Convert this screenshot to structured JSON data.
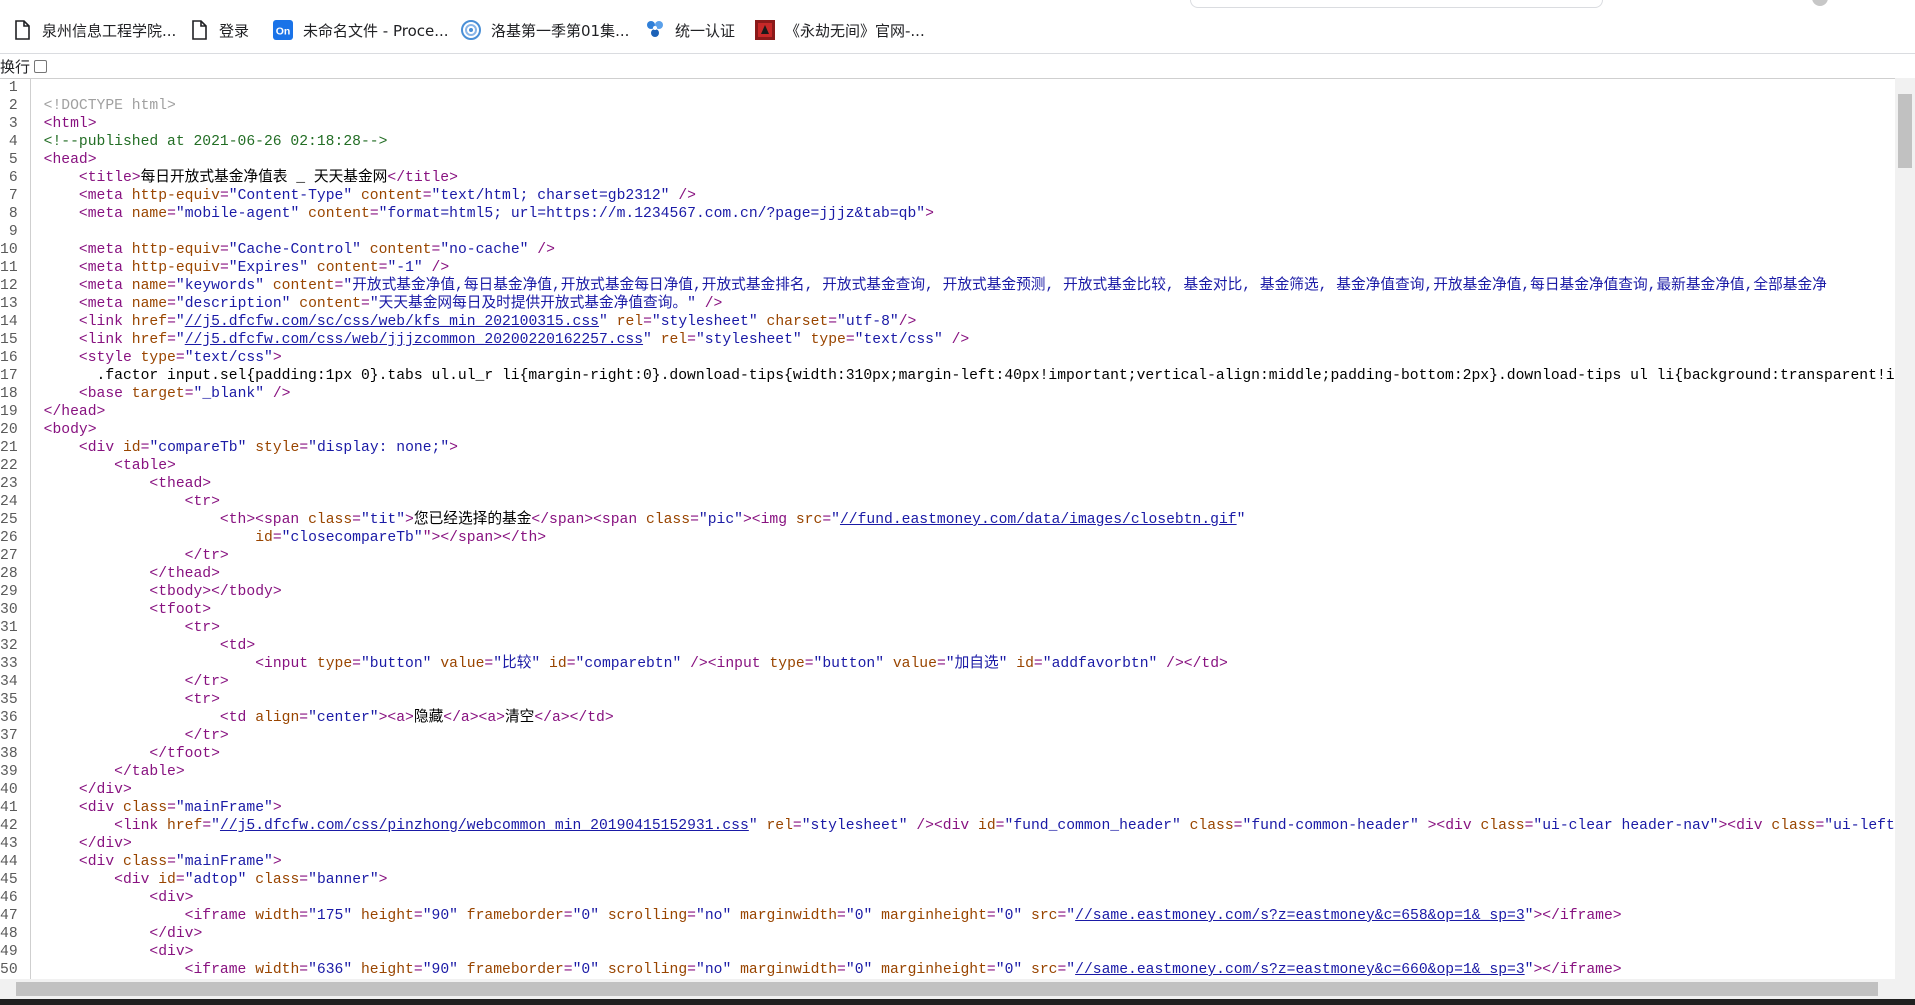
{
  "bookmarks": [
    {
      "label": "泉州信息工程学院...",
      "icon": "page-icon"
    },
    {
      "label": "登录",
      "icon": "page-icon"
    },
    {
      "label": "未命名文件 - Proce...",
      "icon": "processon-icon"
    },
    {
      "label": "洛基第一季第01集...",
      "icon": "swirl-icon"
    },
    {
      "label": "统一认证",
      "icon": "fan-icon"
    },
    {
      "label": "《永劫无间》官网-...",
      "icon": "game-icon"
    }
  ],
  "toolbar": {
    "wrap_label": "换行"
  },
  "lines": [
    [],
    [
      {
        "c": "dt",
        "t": "<!DOCTYPE html>"
      }
    ],
    [
      {
        "c": "tg",
        "t": "<html>"
      }
    ],
    [
      {
        "c": "cm",
        "t": "<!--published at 2021-06-26 02:18:28-->"
      }
    ],
    [
      {
        "c": "tg",
        "t": "<head>"
      }
    ],
    [
      {
        "c": "",
        "t": "    "
      },
      {
        "c": "tg",
        "t": "<title>"
      },
      {
        "c": "",
        "t": "每日开放式基金净值表 _ 天天基金网"
      },
      {
        "c": "tg",
        "t": "</title>"
      }
    ],
    [
      {
        "c": "",
        "t": "    "
      },
      {
        "c": "tg",
        "t": "<meta "
      },
      {
        "c": "an",
        "t": "http-equiv"
      },
      {
        "c": "tg",
        "t": "="
      },
      {
        "c": "av",
        "t": "\"Content-Type\""
      },
      {
        "c": "an",
        "t": " content"
      },
      {
        "c": "tg",
        "t": "="
      },
      {
        "c": "av",
        "t": "\"text/html; charset=gb2312\""
      },
      {
        "c": "tg",
        "t": " />"
      }
    ],
    [
      {
        "c": "",
        "t": "    "
      },
      {
        "c": "tg",
        "t": "<meta "
      },
      {
        "c": "an",
        "t": "name"
      },
      {
        "c": "tg",
        "t": "="
      },
      {
        "c": "av",
        "t": "\"mobile-agent\""
      },
      {
        "c": "an",
        "t": " content"
      },
      {
        "c": "tg",
        "t": "="
      },
      {
        "c": "av",
        "t": "\"format=html5; url=https://m.1234567.com.cn/?page=jjjz&tab=qb\""
      },
      {
        "c": "tg",
        "t": ">"
      }
    ],
    [],
    [
      {
        "c": "",
        "t": "    "
      },
      {
        "c": "tg",
        "t": "<meta "
      },
      {
        "c": "an",
        "t": "http-equiv"
      },
      {
        "c": "tg",
        "t": "="
      },
      {
        "c": "av",
        "t": "\"Cache-Control\""
      },
      {
        "c": "an",
        "t": " content"
      },
      {
        "c": "tg",
        "t": "="
      },
      {
        "c": "av",
        "t": "\"no-cache\""
      },
      {
        "c": "tg",
        "t": " />"
      }
    ],
    [
      {
        "c": "",
        "t": "    "
      },
      {
        "c": "tg",
        "t": "<meta "
      },
      {
        "c": "an",
        "t": "http-equiv"
      },
      {
        "c": "tg",
        "t": "="
      },
      {
        "c": "av",
        "t": "\"Expires\""
      },
      {
        "c": "an",
        "t": " content"
      },
      {
        "c": "tg",
        "t": "="
      },
      {
        "c": "av",
        "t": "\"-1\""
      },
      {
        "c": "tg",
        "t": " />"
      }
    ],
    [
      {
        "c": "",
        "t": "    "
      },
      {
        "c": "tg",
        "t": "<meta "
      },
      {
        "c": "an",
        "t": "name"
      },
      {
        "c": "tg",
        "t": "="
      },
      {
        "c": "av",
        "t": "\"keywords\""
      },
      {
        "c": "an",
        "t": " content"
      },
      {
        "c": "tg",
        "t": "="
      },
      {
        "c": "av",
        "t": "\"开放式基金净值,每日基金净值,开放式基金每日净值,开放式基金排名, 开放式基金查询, 开放式基金预测, 开放式基金比较, 基金对比, 基金筛选, 基金净值查询,开放基金净值,每日基金净值查询,最新基金净值,全部基金净"
      }
    ],
    [
      {
        "c": "",
        "t": "    "
      },
      {
        "c": "tg",
        "t": "<meta "
      },
      {
        "c": "an",
        "t": "name"
      },
      {
        "c": "tg",
        "t": "="
      },
      {
        "c": "av",
        "t": "\"description\""
      },
      {
        "c": "an",
        "t": " content"
      },
      {
        "c": "tg",
        "t": "="
      },
      {
        "c": "av",
        "t": "\"天天基金网每日及时提供开放式基金净值查询。\""
      },
      {
        "c": "tg",
        "t": " />"
      }
    ],
    [
      {
        "c": "",
        "t": "    "
      },
      {
        "c": "tg",
        "t": "<link "
      },
      {
        "c": "an",
        "t": "href"
      },
      {
        "c": "tg",
        "t": "="
      },
      {
        "c": "av",
        "t": "\""
      },
      {
        "c": "lk",
        "t": "//j5.dfcfw.com/sc/css/web/kfs_min_202100315.css"
      },
      {
        "c": "av",
        "t": "\""
      },
      {
        "c": "an",
        "t": " rel"
      },
      {
        "c": "tg",
        "t": "="
      },
      {
        "c": "av",
        "t": "\"stylesheet\""
      },
      {
        "c": "an",
        "t": " charset"
      },
      {
        "c": "tg",
        "t": "="
      },
      {
        "c": "av",
        "t": "\"utf-8\""
      },
      {
        "c": "tg",
        "t": "/>"
      }
    ],
    [
      {
        "c": "",
        "t": "    "
      },
      {
        "c": "tg",
        "t": "<link "
      },
      {
        "c": "an",
        "t": "href"
      },
      {
        "c": "tg",
        "t": "="
      },
      {
        "c": "av",
        "t": "\""
      },
      {
        "c": "lk",
        "t": "//j5.dfcfw.com/css/web/jjjzcommon_20200220162257.css"
      },
      {
        "c": "av",
        "t": "\""
      },
      {
        "c": "an",
        "t": " rel"
      },
      {
        "c": "tg",
        "t": "="
      },
      {
        "c": "av",
        "t": "\"stylesheet\""
      },
      {
        "c": "an",
        "t": " type"
      },
      {
        "c": "tg",
        "t": "="
      },
      {
        "c": "av",
        "t": "\"text/css\""
      },
      {
        "c": "tg",
        "t": " />"
      }
    ],
    [
      {
        "c": "",
        "t": "    "
      },
      {
        "c": "tg",
        "t": "<style "
      },
      {
        "c": "an",
        "t": "type"
      },
      {
        "c": "tg",
        "t": "="
      },
      {
        "c": "av",
        "t": "\"text/css\""
      },
      {
        "c": "tg",
        "t": ">"
      }
    ],
    [
      {
        "c": "",
        "t": "      .factor input.sel{padding:1px 0}.tabs ul.ul_r li{margin-right:0}.download-tips{width:310px;margin-left:40px!important;vertical-align:middle;padding-bottom:2px}.download-tips ul li{background:transparent!important;width:310px!"
      }
    ],
    [
      {
        "c": "",
        "t": "    "
      },
      {
        "c": "tg",
        "t": "<base "
      },
      {
        "c": "an",
        "t": "target"
      },
      {
        "c": "tg",
        "t": "="
      },
      {
        "c": "av",
        "t": "\"_blank\""
      },
      {
        "c": "tg",
        "t": " />"
      }
    ],
    [
      {
        "c": "tg",
        "t": "</head>"
      }
    ],
    [
      {
        "c": "tg",
        "t": "<body>"
      }
    ],
    [
      {
        "c": "",
        "t": "    "
      },
      {
        "c": "tg",
        "t": "<div "
      },
      {
        "c": "an",
        "t": "id"
      },
      {
        "c": "tg",
        "t": "="
      },
      {
        "c": "av",
        "t": "\"compareTb\""
      },
      {
        "c": "an",
        "t": " style"
      },
      {
        "c": "tg",
        "t": "="
      },
      {
        "c": "av",
        "t": "\"display: none;\""
      },
      {
        "c": "tg",
        "t": ">"
      }
    ],
    [
      {
        "c": "",
        "t": "        "
      },
      {
        "c": "tg",
        "t": "<table>"
      }
    ],
    [
      {
        "c": "",
        "t": "            "
      },
      {
        "c": "tg",
        "t": "<thead>"
      }
    ],
    [
      {
        "c": "",
        "t": "                "
      },
      {
        "c": "tg",
        "t": "<tr>"
      }
    ],
    [
      {
        "c": "",
        "t": "                    "
      },
      {
        "c": "tg",
        "t": "<th><span "
      },
      {
        "c": "an",
        "t": "class"
      },
      {
        "c": "tg",
        "t": "="
      },
      {
        "c": "av",
        "t": "\"tit\""
      },
      {
        "c": "tg",
        "t": ">"
      },
      {
        "c": "",
        "t": "您已经选择的基金"
      },
      {
        "c": "tg",
        "t": "</span><span "
      },
      {
        "c": "an",
        "t": "class"
      },
      {
        "c": "tg",
        "t": "="
      },
      {
        "c": "av",
        "t": "\"pic\""
      },
      {
        "c": "tg",
        "t": "><img "
      },
      {
        "c": "an",
        "t": "src"
      },
      {
        "c": "tg",
        "t": "="
      },
      {
        "c": "av",
        "t": "\""
      },
      {
        "c": "lk",
        "t": "//fund.eastmoney.com/data/images/closebtn.gif"
      },
      {
        "c": "av",
        "t": "\""
      }
    ],
    [
      {
        "c": "",
        "t": "                        "
      },
      {
        "c": "an",
        "t": "id"
      },
      {
        "c": "tg",
        "t": "="
      },
      {
        "c": "av",
        "t": "\"closecompareTb\""
      },
      {
        "c": "tg",
        "t": "\"></span></th>"
      }
    ],
    [
      {
        "c": "",
        "t": "                "
      },
      {
        "c": "tg",
        "t": "</tr>"
      }
    ],
    [
      {
        "c": "",
        "t": "            "
      },
      {
        "c": "tg",
        "t": "</thead>"
      }
    ],
    [
      {
        "c": "",
        "t": "            "
      },
      {
        "c": "tg",
        "t": "<tbody></tbody>"
      }
    ],
    [
      {
        "c": "",
        "t": "            "
      },
      {
        "c": "tg",
        "t": "<tfoot>"
      }
    ],
    [
      {
        "c": "",
        "t": "                "
      },
      {
        "c": "tg",
        "t": "<tr>"
      }
    ],
    [
      {
        "c": "",
        "t": "                    "
      },
      {
        "c": "tg",
        "t": "<td>"
      }
    ],
    [
      {
        "c": "",
        "t": "                        "
      },
      {
        "c": "tg",
        "t": "<input "
      },
      {
        "c": "an",
        "t": "type"
      },
      {
        "c": "tg",
        "t": "="
      },
      {
        "c": "av",
        "t": "\"button\""
      },
      {
        "c": "an",
        "t": " value"
      },
      {
        "c": "tg",
        "t": "="
      },
      {
        "c": "av",
        "t": "\"比较\""
      },
      {
        "c": "an",
        "t": " id"
      },
      {
        "c": "tg",
        "t": "="
      },
      {
        "c": "av",
        "t": "\"comparebtn\""
      },
      {
        "c": "tg",
        "t": " /><input "
      },
      {
        "c": "an",
        "t": "type"
      },
      {
        "c": "tg",
        "t": "="
      },
      {
        "c": "av",
        "t": "\"button\""
      },
      {
        "c": "an",
        "t": " value"
      },
      {
        "c": "tg",
        "t": "="
      },
      {
        "c": "av",
        "t": "\"加自选\""
      },
      {
        "c": "an",
        "t": " id"
      },
      {
        "c": "tg",
        "t": "="
      },
      {
        "c": "av",
        "t": "\"addfavorbtn\""
      },
      {
        "c": "tg",
        "t": " /></td>"
      }
    ],
    [
      {
        "c": "",
        "t": "                "
      },
      {
        "c": "tg",
        "t": "</tr>"
      }
    ],
    [
      {
        "c": "",
        "t": "                "
      },
      {
        "c": "tg",
        "t": "<tr>"
      }
    ],
    [
      {
        "c": "",
        "t": "                    "
      },
      {
        "c": "tg",
        "t": "<td "
      },
      {
        "c": "an",
        "t": "align"
      },
      {
        "c": "tg",
        "t": "="
      },
      {
        "c": "av",
        "t": "\"center\""
      },
      {
        "c": "tg",
        "t": "><a>"
      },
      {
        "c": "",
        "t": "隐藏"
      },
      {
        "c": "tg",
        "t": "</a><a>"
      },
      {
        "c": "",
        "t": "清空"
      },
      {
        "c": "tg",
        "t": "</a></td>"
      }
    ],
    [
      {
        "c": "",
        "t": "                "
      },
      {
        "c": "tg",
        "t": "</tr>"
      }
    ],
    [
      {
        "c": "",
        "t": "            "
      },
      {
        "c": "tg",
        "t": "</tfoot>"
      }
    ],
    [
      {
        "c": "",
        "t": "        "
      },
      {
        "c": "tg",
        "t": "</table>"
      }
    ],
    [
      {
        "c": "",
        "t": "    "
      },
      {
        "c": "tg",
        "t": "</div>"
      }
    ],
    [
      {
        "c": "",
        "t": "    "
      },
      {
        "c": "tg",
        "t": "<div "
      },
      {
        "c": "an",
        "t": "class"
      },
      {
        "c": "tg",
        "t": "="
      },
      {
        "c": "av",
        "t": "\"mainFrame\""
      },
      {
        "c": "tg",
        "t": ">"
      }
    ],
    [
      {
        "c": "",
        "t": "        "
      },
      {
        "c": "tg",
        "t": "<link "
      },
      {
        "c": "an",
        "t": "href"
      },
      {
        "c": "tg",
        "t": "="
      },
      {
        "c": "av",
        "t": "\""
      },
      {
        "c": "lk",
        "t": "//j5.dfcfw.com/css/pinzhong/webcommon_min_20190415152931.css"
      },
      {
        "c": "av",
        "t": "\""
      },
      {
        "c": "an",
        "t": " rel"
      },
      {
        "c": "tg",
        "t": "="
      },
      {
        "c": "av",
        "t": "\"stylesheet\""
      },
      {
        "c": "tg",
        "t": " /><div "
      },
      {
        "c": "an",
        "t": "id"
      },
      {
        "c": "tg",
        "t": "="
      },
      {
        "c": "av",
        "t": "\"fund_common_header\""
      },
      {
        "c": "an",
        "t": " class"
      },
      {
        "c": "tg",
        "t": "="
      },
      {
        "c": "av",
        "t": "\"fund-common-header\""
      },
      {
        "c": "tg",
        "t": " ><div "
      },
      {
        "c": "an",
        "t": "class"
      },
      {
        "c": "tg",
        "t": "="
      },
      {
        "c": "av",
        "t": "\"ui-clear header-nav\""
      },
      {
        "c": "tg",
        "t": "><div "
      },
      {
        "c": "an",
        "t": "class"
      },
      {
        "c": "tg",
        "t": "="
      },
      {
        "c": "av",
        "t": "\"ui-left\""
      },
      {
        "c": "tg",
        "t": "><ul><li "
      },
      {
        "c": "an",
        "t": "class"
      },
      {
        "c": "tg",
        "t": "="
      },
      {
        "c": "av",
        "t": "\"head"
      }
    ],
    [
      {
        "c": "",
        "t": "    "
      },
      {
        "c": "tg",
        "t": "</div>"
      }
    ],
    [
      {
        "c": "",
        "t": "    "
      },
      {
        "c": "tg",
        "t": "<div "
      },
      {
        "c": "an",
        "t": "class"
      },
      {
        "c": "tg",
        "t": "="
      },
      {
        "c": "av",
        "t": "\"mainFrame\""
      },
      {
        "c": "tg",
        "t": ">"
      }
    ],
    [
      {
        "c": "",
        "t": "        "
      },
      {
        "c": "tg",
        "t": "<div "
      },
      {
        "c": "an",
        "t": "id"
      },
      {
        "c": "tg",
        "t": "="
      },
      {
        "c": "av",
        "t": "\"adtop\""
      },
      {
        "c": "an",
        "t": " class"
      },
      {
        "c": "tg",
        "t": "="
      },
      {
        "c": "av",
        "t": "\"banner\""
      },
      {
        "c": "tg",
        "t": ">"
      }
    ],
    [
      {
        "c": "",
        "t": "            "
      },
      {
        "c": "tg",
        "t": "<div>"
      }
    ],
    [
      {
        "c": "",
        "t": "                "
      },
      {
        "c": "tg",
        "t": "<iframe "
      },
      {
        "c": "an",
        "t": "width"
      },
      {
        "c": "tg",
        "t": "="
      },
      {
        "c": "av",
        "t": "\"175\""
      },
      {
        "c": "an",
        "t": " height"
      },
      {
        "c": "tg",
        "t": "="
      },
      {
        "c": "av",
        "t": "\"90\""
      },
      {
        "c": "an",
        "t": " frameborder"
      },
      {
        "c": "tg",
        "t": "="
      },
      {
        "c": "av",
        "t": "\"0\""
      },
      {
        "c": "an",
        "t": " scrolling"
      },
      {
        "c": "tg",
        "t": "="
      },
      {
        "c": "av",
        "t": "\"no\""
      },
      {
        "c": "an",
        "t": " marginwidth"
      },
      {
        "c": "tg",
        "t": "="
      },
      {
        "c": "av",
        "t": "\"0\""
      },
      {
        "c": "an",
        "t": " marginheight"
      },
      {
        "c": "tg",
        "t": "="
      },
      {
        "c": "av",
        "t": "\"0\""
      },
      {
        "c": "an",
        "t": " src"
      },
      {
        "c": "tg",
        "t": "="
      },
      {
        "c": "av",
        "t": "\""
      },
      {
        "c": "lk",
        "t": "//same.eastmoney.com/s?z=eastmoney&c=658&op=1&_sp=3"
      },
      {
        "c": "av",
        "t": "\""
      },
      {
        "c": "tg",
        "t": "></iframe>"
      }
    ],
    [
      {
        "c": "",
        "t": "            "
      },
      {
        "c": "tg",
        "t": "</div>"
      }
    ],
    [
      {
        "c": "",
        "t": "            "
      },
      {
        "c": "tg",
        "t": "<div>"
      }
    ],
    [
      {
        "c": "",
        "t": "                "
      },
      {
        "c": "tg",
        "t": "<iframe "
      },
      {
        "c": "an",
        "t": "width"
      },
      {
        "c": "tg",
        "t": "="
      },
      {
        "c": "av",
        "t": "\"636\""
      },
      {
        "c": "an",
        "t": " height"
      },
      {
        "c": "tg",
        "t": "="
      },
      {
        "c": "av",
        "t": "\"90\""
      },
      {
        "c": "an",
        "t": " frameborder"
      },
      {
        "c": "tg",
        "t": "="
      },
      {
        "c": "av",
        "t": "\"0\""
      },
      {
        "c": "an",
        "t": " scrolling"
      },
      {
        "c": "tg",
        "t": "="
      },
      {
        "c": "av",
        "t": "\"no\""
      },
      {
        "c": "an",
        "t": " marginwidth"
      },
      {
        "c": "tg",
        "t": "="
      },
      {
        "c": "av",
        "t": "\"0\""
      },
      {
        "c": "an",
        "t": " marginheight"
      },
      {
        "c": "tg",
        "t": "="
      },
      {
        "c": "av",
        "t": "\"0\""
      },
      {
        "c": "an",
        "t": " src"
      },
      {
        "c": "tg",
        "t": "="
      },
      {
        "c": "av",
        "t": "\""
      },
      {
        "c": "lk",
        "t": "//same.eastmoney.com/s?z=eastmoney&c=660&op=1&_sp=3"
      },
      {
        "c": "av",
        "t": "\""
      },
      {
        "c": "tg",
        "t": "></iframe>"
      }
    ],
    [
      {
        "c": "",
        "t": "            "
      },
      {
        "c": "tg",
        "t": "</div>"
      }
    ]
  ]
}
